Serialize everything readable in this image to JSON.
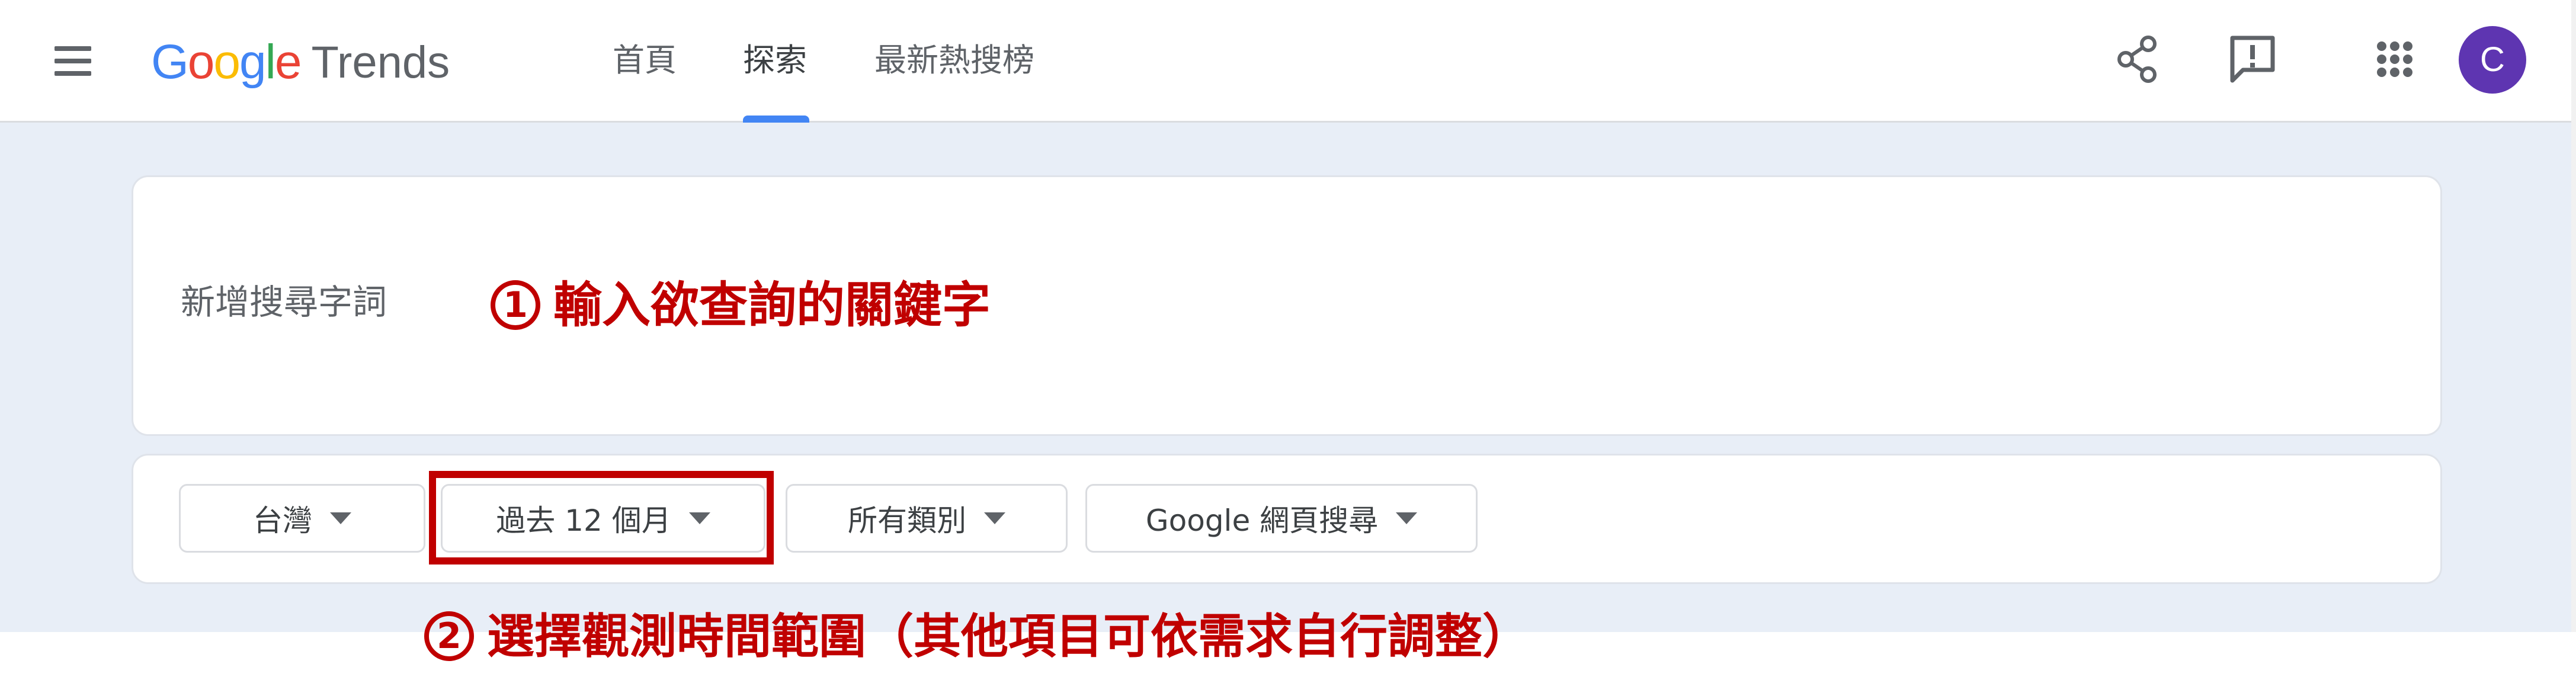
{
  "header": {
    "logo_text": "Google",
    "logo_suffix": "Trends",
    "tabs": [
      {
        "label": "首頁",
        "active": false
      },
      {
        "label": "探索",
        "active": true
      },
      {
        "label": "最新熱搜榜",
        "active": false
      }
    ],
    "icons": [
      "menu-icon",
      "share-icon",
      "feedback-icon",
      "apps-icon"
    ],
    "avatar_letter": "C",
    "accent_color": "#4285f4",
    "avatar_color": "#5e35b1"
  },
  "search": {
    "placeholder": "新增搜尋字詞"
  },
  "filters": [
    {
      "label": "台灣"
    },
    {
      "label": "過去 12 個月"
    },
    {
      "label": "所有類別"
    },
    {
      "label": "Google 網頁搜尋"
    }
  ],
  "annotations": {
    "step1_number": "1",
    "step1_text": "輸入欲查詢的關鍵字",
    "step2_number": "2",
    "step2_text": "選擇觀測時間範圍（其他項目可依需求自行調整）",
    "color": "#c00000"
  }
}
